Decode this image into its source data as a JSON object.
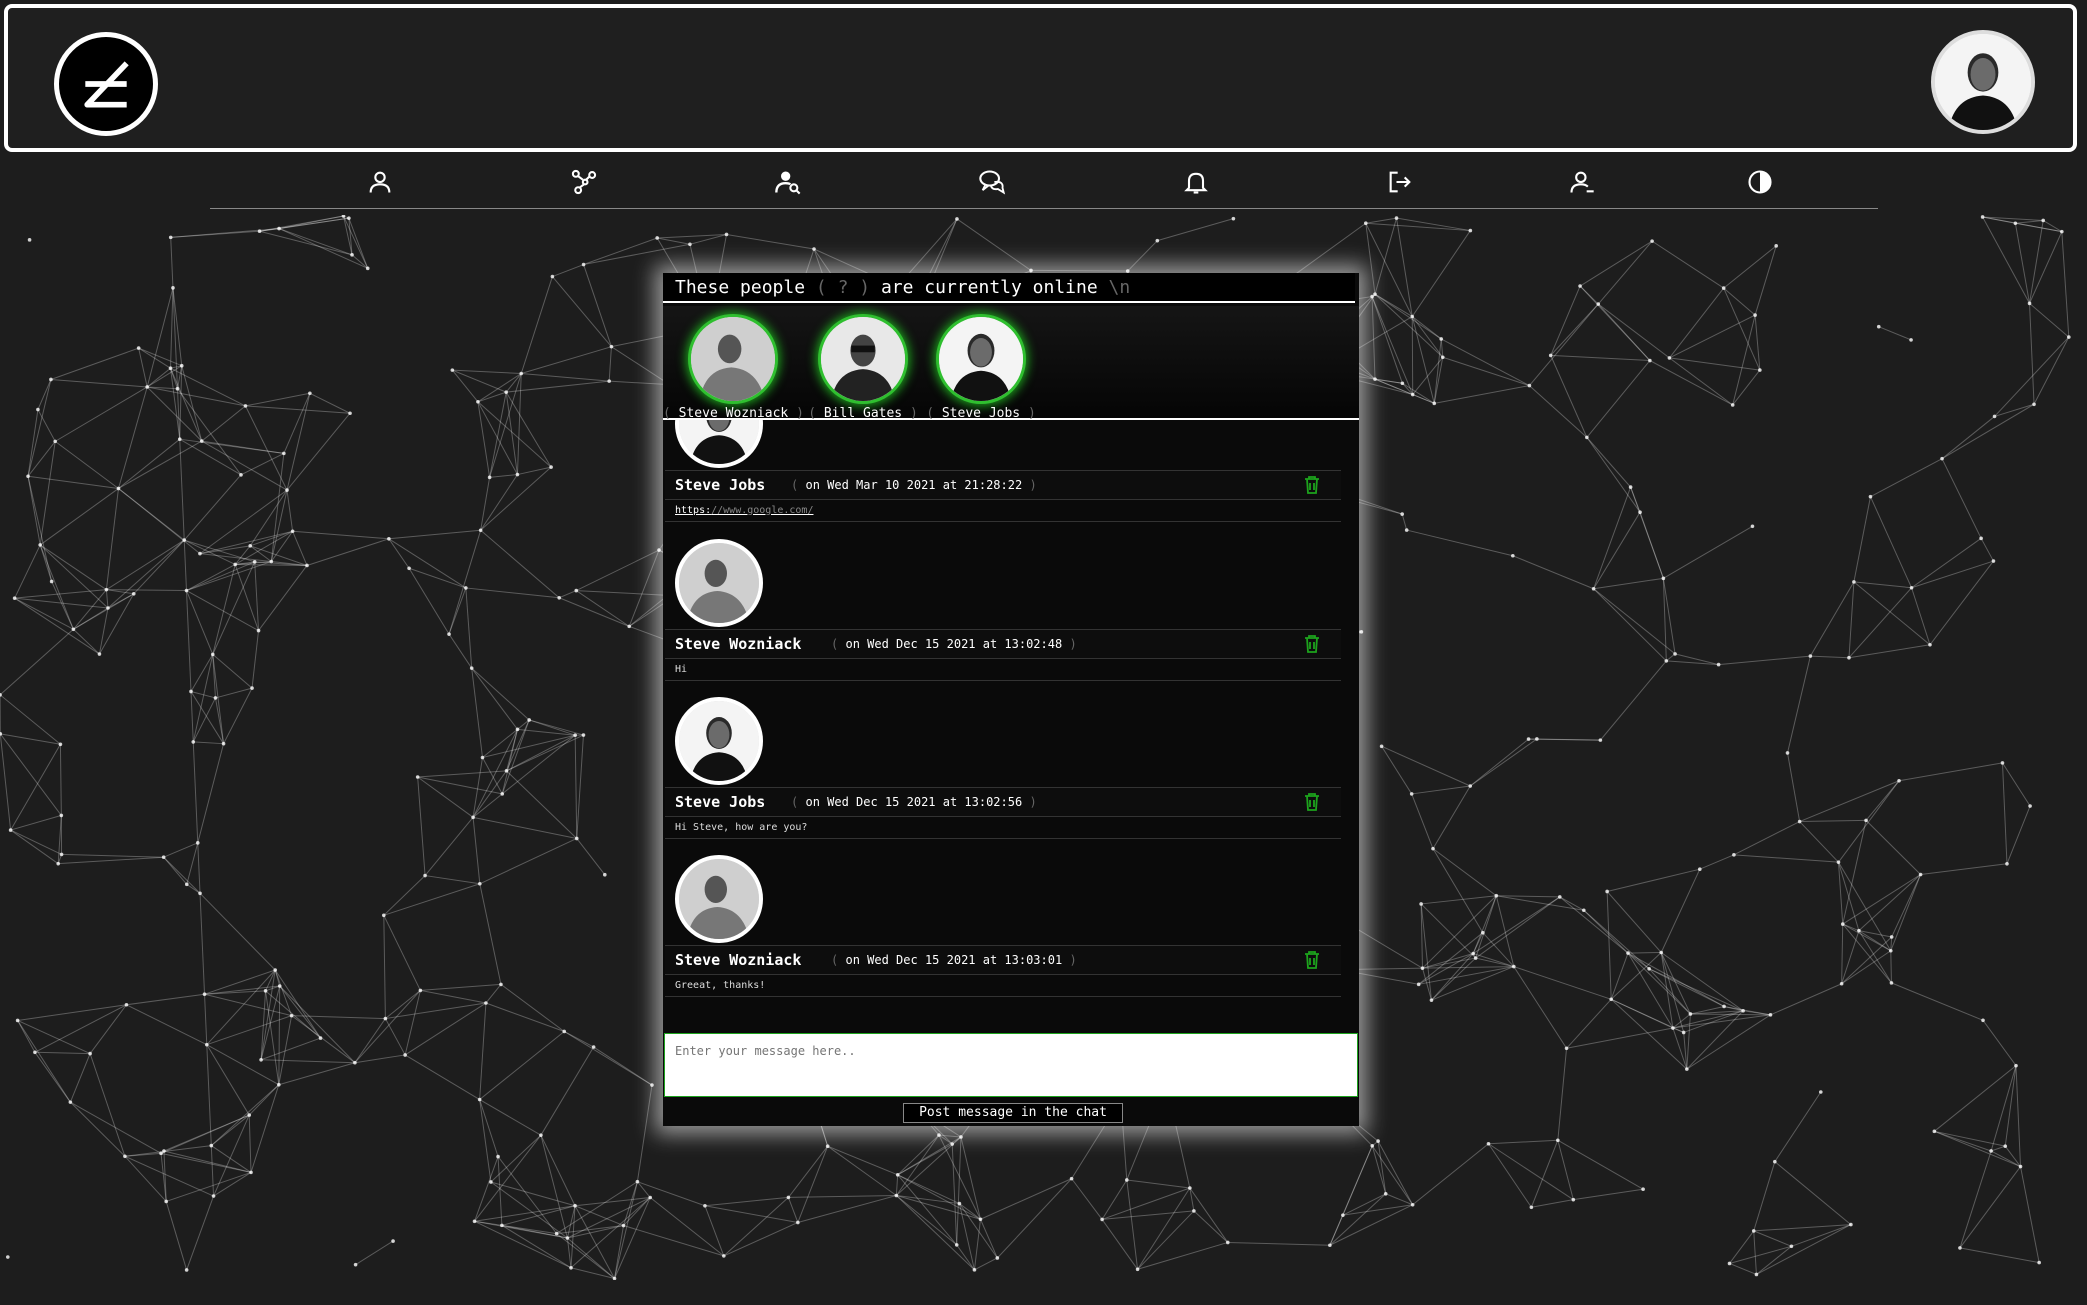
{
  "colors": {
    "accent": "#1da31d",
    "background": "#1d1d1d",
    "panel": "#0a0a0a"
  },
  "header": {
    "logo_icon": "network-logo-icon",
    "avatar_label": "Steve Jobs"
  },
  "nav": {
    "items": [
      {
        "name": "profile",
        "icon": "user-icon"
      },
      {
        "name": "network",
        "icon": "graph-icon"
      },
      {
        "name": "search-users",
        "icon": "user-search-icon"
      },
      {
        "name": "chat",
        "icon": "chat-bubbles-icon"
      },
      {
        "name": "notifications",
        "icon": "bell-icon"
      },
      {
        "name": "logout",
        "icon": "logout-icon"
      },
      {
        "name": "remove-user",
        "icon": "user-minus-icon"
      },
      {
        "name": "theme",
        "icon": "contrast-icon"
      }
    ]
  },
  "online": {
    "title_prefix": "These people",
    "title_open": "(",
    "title_count": "?",
    "title_close": ")",
    "title_suffix": "are currently online",
    "title_newline": "\\n",
    "users": [
      {
        "name": "Steve Wozniack"
      },
      {
        "name": "Bill Gates"
      },
      {
        "name": "Steve Jobs"
      }
    ]
  },
  "messages": [
    {
      "author": "Steve Jobs",
      "date": "on Wed Mar 10 2021 at 21:28:22",
      "text_link_scheme": "https:",
      "text_link_rest": "//www.google.com/"
    },
    {
      "author": "Steve Wozniack",
      "date": "on Wed Dec 15 2021 at 13:02:48",
      "text": "Hi"
    },
    {
      "author": "Steve Jobs",
      "date": "on Wed Dec 15 2021 at 13:02:56",
      "text": "Hi Steve, how are you?"
    },
    {
      "author": "Steve Wozniack",
      "date": "on Wed Dec 15 2021 at 13:03:01",
      "text": "Greeat, thanks!"
    }
  ],
  "composer": {
    "placeholder": "Enter your message here..",
    "post_label": "Post message in the chat"
  }
}
